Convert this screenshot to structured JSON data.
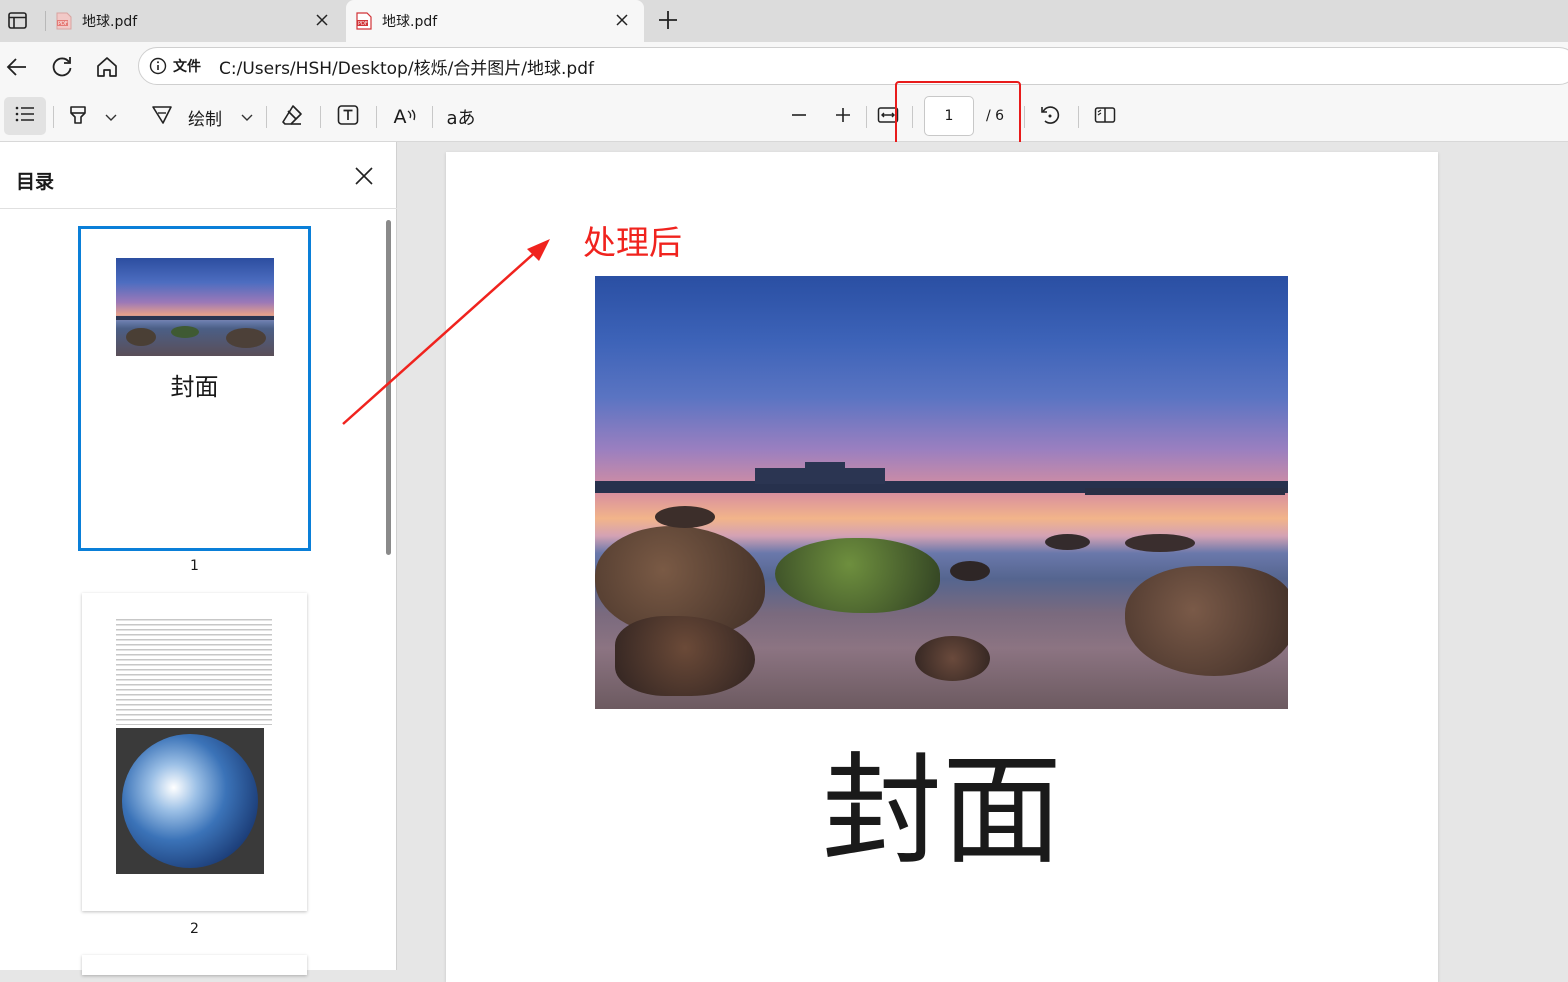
{
  "tabs": [
    {
      "title": "地球.pdf",
      "active": false
    },
    {
      "title": "地球.pdf",
      "active": true
    }
  ],
  "address": {
    "label": "文件",
    "path": "C:/Users/HSH/Desktop/核烁/合并图片/地球.pdf"
  },
  "toolbar": {
    "draw_label": "绘制",
    "page_current": "1",
    "page_total": "/ 6",
    "read_aloud_glyph": "A",
    "translate_glyph": "aあ"
  },
  "sidebar": {
    "title": "目录",
    "thumbnails": [
      {
        "number": "1",
        "caption": "封面",
        "selected": true
      },
      {
        "number": "2",
        "caption": "",
        "selected": false
      }
    ]
  },
  "page": {
    "annotation": "处理后",
    "cover_title": "封面"
  },
  "colors": {
    "accent": "#0a7fd8",
    "annotation_red": "#f0231e",
    "highlight_box": "#e81b1b"
  },
  "icons": [
    "sidebar-toggle-icon",
    "pdf-icon",
    "close-icon",
    "new-tab-icon",
    "back-icon",
    "refresh-icon",
    "home-icon",
    "info-icon",
    "contents-icon",
    "highlighter-icon",
    "draw-icon",
    "eraser-icon",
    "text-box-icon",
    "read-aloud-icon",
    "translate-icon",
    "zoom-out-icon",
    "zoom-in-icon",
    "fit-width-icon",
    "rotate-icon",
    "two-page-icon"
  ]
}
